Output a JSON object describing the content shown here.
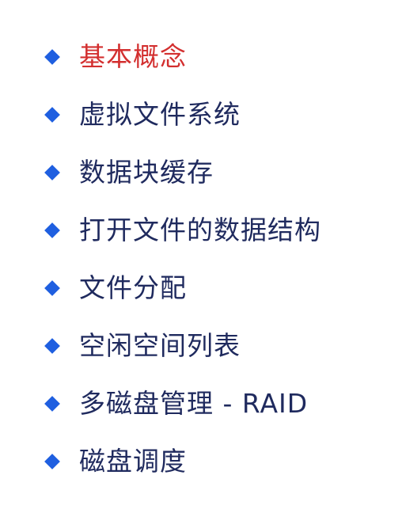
{
  "outline": {
    "items": [
      {
        "label": "基本概念",
        "active": true
      },
      {
        "label": "虚拟文件系统",
        "active": false
      },
      {
        "label": "数据块缓存",
        "active": false
      },
      {
        "label": "打开文件的数据结构",
        "active": false
      },
      {
        "label": "文件分配",
        "active": false
      },
      {
        "label": "空闲空间列表",
        "active": false
      },
      {
        "label": "多磁盘管理 - RAID",
        "active": false
      },
      {
        "label": "磁盘调度",
        "active": false
      }
    ]
  },
  "colors": {
    "bullet": "#1f5fe0",
    "text": "#1f2a5e",
    "active_text": "#d32f2f"
  },
  "icons": {
    "bullet": "diamond-bullet-icon"
  }
}
